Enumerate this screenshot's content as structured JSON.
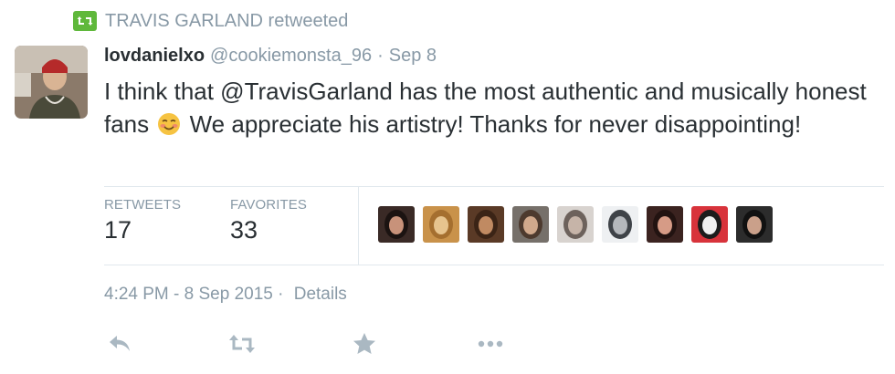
{
  "retweet_context": {
    "icon": "retweet-icon",
    "label": "TRAVIS GARLAND retweeted",
    "color": "#5fb83b"
  },
  "tweet": {
    "author": {
      "display_name": "lovdanielxo",
      "screen_name": "@cookiemonsta_96",
      "separator": "·",
      "time": "Sep 8"
    },
    "text_before_emoji": "I think that @TravisGarland has the most authentic and musically honest fans ",
    "emoji": "blushing-smile-emoji",
    "text_after_emoji": " We appreciate his artistry! Thanks for never disappointing!"
  },
  "stats": {
    "retweets_label": "RETWEETS",
    "retweets_count": "17",
    "favorites_label": "FAVORITES",
    "favorites_count": "33"
  },
  "favoriters": [
    {
      "name": "favoriter-avatar-1",
      "bg": "#3a2a26",
      "skin": "#c8927a",
      "hair": "#1b1311"
    },
    {
      "name": "favoriter-avatar-2",
      "bg": "#c9924a",
      "skin": "#e7c48e",
      "hair": "#a56f2f"
    },
    {
      "name": "favoriter-avatar-3",
      "bg": "#5a3a26",
      "skin": "#c08a62",
      "hair": "#3b2416"
    },
    {
      "name": "favoriter-avatar-4",
      "bg": "#76706a",
      "skin": "#d1a98c",
      "hair": "#4d3a2e"
    },
    {
      "name": "favoriter-avatar-5",
      "bg": "#d8d3cf",
      "skin": "#c6b4a8",
      "hair": "#6d625c"
    },
    {
      "name": "favoriter-avatar-6",
      "bg": "#eef0f2",
      "skin": "#b5b8bc",
      "hair": "#3f4348"
    },
    {
      "name": "favoriter-avatar-7",
      "bg": "#3b2320",
      "skin": "#d69b86",
      "hair": "#221311"
    },
    {
      "name": "favoriter-avatar-8",
      "bg": "#d8333b",
      "skin": "#f0f0f0",
      "hair": "#1c1c1c"
    },
    {
      "name": "favoriter-avatar-9",
      "bg": "#2c2c2c",
      "skin": "#caa08a",
      "hair": "#111111"
    }
  ],
  "footer": {
    "timestamp": "4:24 PM - 8 Sep 2015",
    "separator": "·",
    "details_link": "Details"
  },
  "actions": [
    {
      "name": "reply-icon"
    },
    {
      "name": "retweet-action-icon"
    },
    {
      "name": "favorite-star-icon"
    },
    {
      "name": "more-options-icon"
    }
  ],
  "colors": {
    "muted": "#8899a6",
    "text": "#292f33",
    "divider": "#e1e8ed",
    "action_icon": "#aab8c2"
  }
}
